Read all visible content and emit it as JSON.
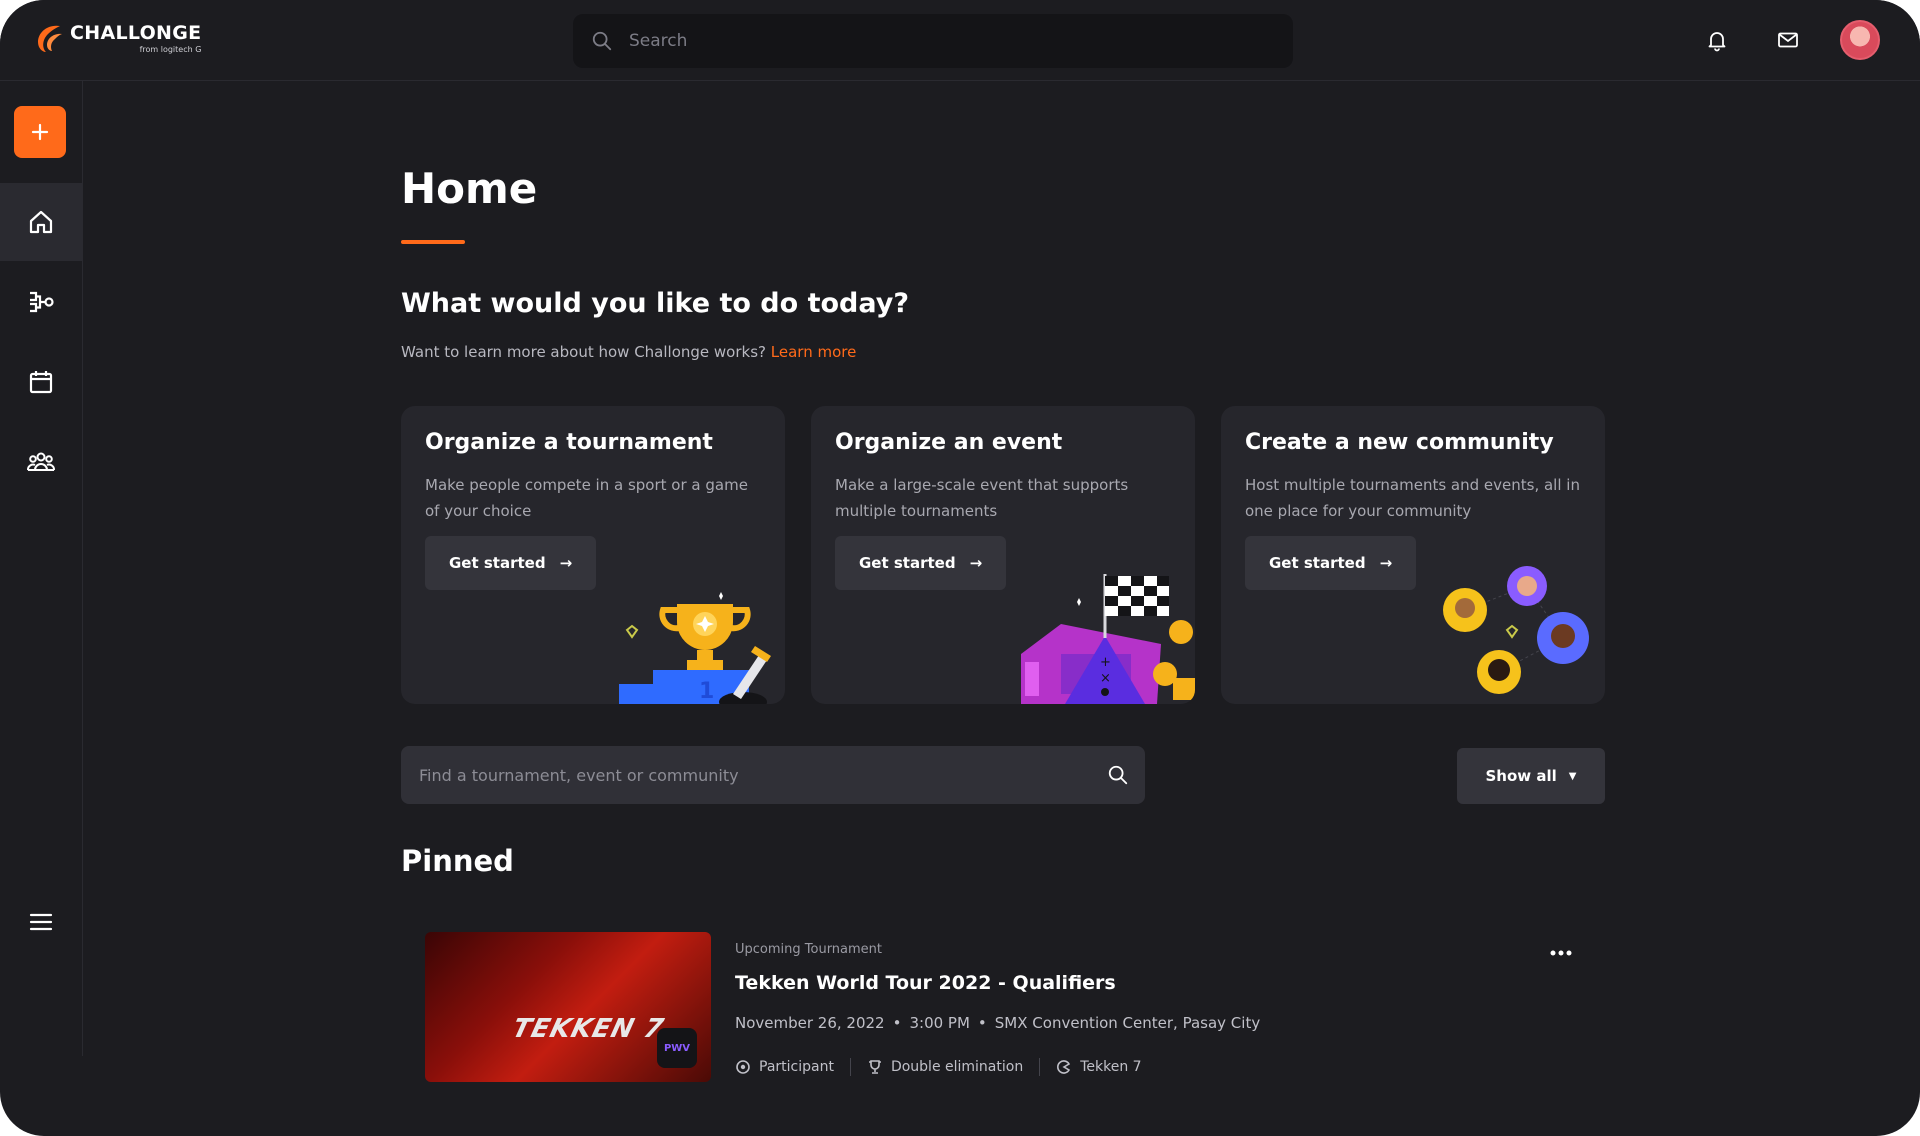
{
  "app": {
    "logo_name": "CHALLONGE",
    "logo_sub": "from logitech G",
    "accent": "#ff6a1a"
  },
  "topbar": {
    "search_placeholder": "Search",
    "icons": [
      "bell-icon",
      "mail-icon",
      "avatar"
    ]
  },
  "sidebar": {
    "add_label": "+",
    "items": [
      {
        "name": "home",
        "icon": "home-icon",
        "active": true
      },
      {
        "name": "brackets",
        "icon": "bracket-icon",
        "active": false
      },
      {
        "name": "events",
        "icon": "calendar-icon",
        "active": false
      },
      {
        "name": "communities",
        "icon": "community-icon",
        "active": false
      }
    ],
    "menu_icon": "hamburger-icon"
  },
  "main": {
    "title": "Home",
    "heading": "What would you like to do today?",
    "subtext": "Want to learn more about how Challonge works?",
    "learn_more": "Learn more",
    "cards": [
      {
        "title": "Organize a tournament",
        "desc": "Make people compete in a sport or a game of your choice",
        "button": "Get started",
        "illustration": "trophy-podium"
      },
      {
        "title": "Organize an event",
        "desc": "Make a large-scale event that supports multiple tournaments",
        "button": "Get started",
        "illustration": "tickets-flag"
      },
      {
        "title": "Create a new community",
        "desc": "Host multiple tournaments and events, all in one place for your community",
        "button": "Get started",
        "illustration": "community-avatars"
      }
    ],
    "find_placeholder": "Find a tournament, event or community",
    "show_all": "Show all",
    "pinned_title": "Pinned",
    "pinned": [
      {
        "type": "Upcoming Tournament",
        "title": "Tekken World Tour 2022 - Qualifiers",
        "date": "November 26, 2022",
        "time": "3:00 PM",
        "location": "SMX Convention Center, Pasay City",
        "thumb_text": "TEKKEN 7",
        "badge_text": "PWV",
        "tags": [
          "Participant",
          "Double elimination",
          "Tekken 7"
        ]
      }
    ]
  }
}
